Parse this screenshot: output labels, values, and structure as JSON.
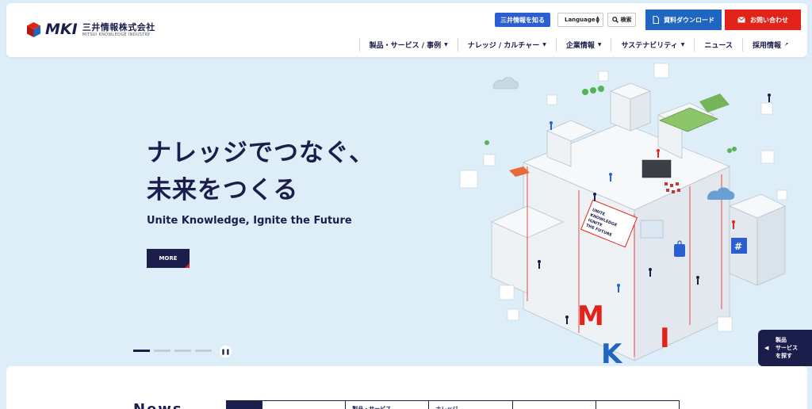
{
  "brand": {
    "logo_mark": "MKI",
    "name_jp": "三井情報株式会社",
    "name_en": "MITSUI KNOWLEDGE INDUSTRY"
  },
  "utility": {
    "about": "三井情報を知る",
    "language": "Language",
    "search": "検索",
    "download": "資料ダウンロード",
    "contact": "お問い合わせ"
  },
  "nav": [
    {
      "label": "製品・サービス / 事例",
      "caret": "▼"
    },
    {
      "label": "ナレッジ / カルチャー",
      "caret": "▼"
    },
    {
      "label": "企業情報",
      "caret": "▼"
    },
    {
      "label": "サステナビリティ",
      "caret": "▼"
    },
    {
      "label": "ニュース",
      "caret": ""
    },
    {
      "label": "採用情報",
      "caret": "↗"
    }
  ],
  "hero": {
    "title_line1": "ナレッジでつなぐ、",
    "title_line2": "未来をつくる",
    "subtitle": "Unite Knowledge, Ignite the Future",
    "more": "MORE",
    "slides_total": 4,
    "slide_active": 1,
    "pause_symbol": "❚❚"
  },
  "side_tab": {
    "arrow": "◀",
    "line1": "製品",
    "line2": "サービス",
    "line3": "を探す"
  },
  "news": {
    "title": "News",
    "tabs": [
      "",
      "",
      "製品・サービス",
      "ナレッジ",
      "",
      ""
    ]
  },
  "illustration": {
    "letters": [
      "M",
      "K",
      "I"
    ],
    "sign_text": "UNITE KNOWLEDGE IGNITE THE FUTURE",
    "colors": {
      "navy": "#1b1d4a",
      "red": "#e2231a",
      "blue": "#2b5fcf",
      "green": "#5cb85c",
      "sky": "#ddeef8"
    }
  }
}
